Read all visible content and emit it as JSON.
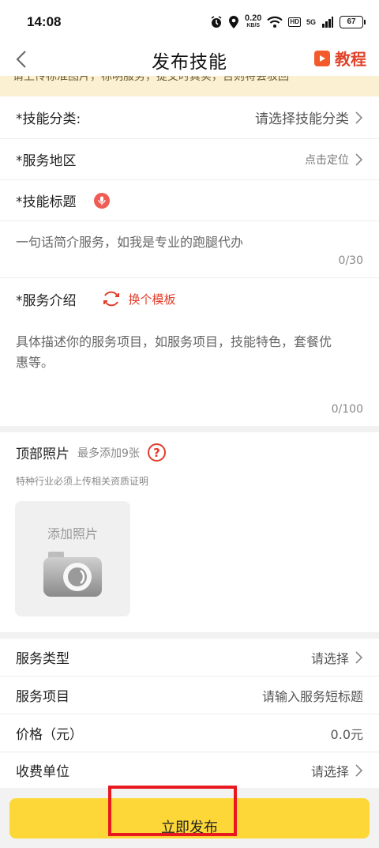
{
  "status_bar": {
    "time": "14:08",
    "net_speed": "0.20",
    "net_unit": "KB/S",
    "hd": "HD",
    "network": "5G",
    "battery": "67"
  },
  "nav": {
    "title": "发布技能",
    "tutorial": "教程"
  },
  "notice": {
    "text": "请上传标准图片，标明服务，提交时真实，否则将会驳回"
  },
  "form": {
    "category_label": "*技能分类:",
    "category_value": "请选择技能分类",
    "area_label": "*服务地区",
    "area_value": "点击定位",
    "title_label": "*技能标题",
    "title_placeholder": "一句话简介服务，如我是专业的跑腿代办",
    "title_counter": "0/30",
    "intro_label": "*服务介绍",
    "template_label": "换个模板",
    "intro_placeholder_1": "具体描述你的服务项目，如服务项目，技能特色，套餐优",
    "intro_placeholder_2": "惠等。",
    "intro_counter": "0/100"
  },
  "photos": {
    "title": "顶部照片",
    "limit": "最多添加9张",
    "help": "?",
    "note": "特种行业必须上传相关资质证明",
    "add_label": "添加照片"
  },
  "details": {
    "type_label": "服务类型",
    "type_value": "请选择",
    "item_label": "服务项目",
    "item_value": "请输入服务短标题",
    "price_label": "价格（元）",
    "price_value": "0.0元",
    "unit_label": "收费单位",
    "unit_value": "请选择"
  },
  "publish": {
    "label": "立即发布"
  },
  "colors": {
    "accent": "#fdd738",
    "red": "#e23c2a",
    "highlight_frame": "#e8181f"
  }
}
